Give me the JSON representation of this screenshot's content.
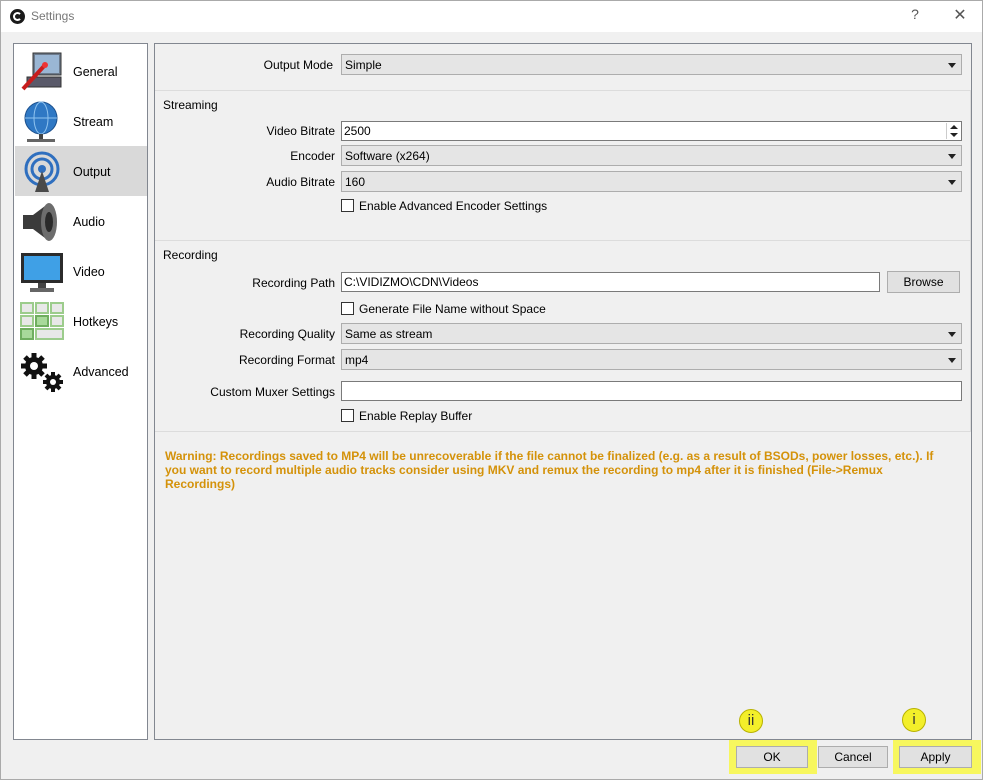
{
  "window": {
    "title": "Settings",
    "help_label": "?",
    "close_label": "✕"
  },
  "sidebar": {
    "items": [
      {
        "label": "General",
        "icon": "general-icon"
      },
      {
        "label": "Stream",
        "icon": "stream-icon"
      },
      {
        "label": "Output",
        "icon": "output-icon",
        "selected": true
      },
      {
        "label": "Audio",
        "icon": "audio-icon"
      },
      {
        "label": "Video",
        "icon": "video-icon"
      },
      {
        "label": "Hotkeys",
        "icon": "hotkeys-icon"
      },
      {
        "label": "Advanced",
        "icon": "advanced-icon"
      }
    ]
  },
  "output": {
    "mode_label": "Output Mode",
    "mode_value": "Simple",
    "streaming": {
      "title": "Streaming",
      "video_bitrate_label": "Video Bitrate",
      "video_bitrate_value": "2500",
      "encoder_label": "Encoder",
      "encoder_value": "Software (x264)",
      "audio_bitrate_label": "Audio Bitrate",
      "audio_bitrate_value": "160",
      "advanced_encoder_label": "Enable Advanced Encoder Settings"
    },
    "recording": {
      "title": "Recording",
      "path_label": "Recording Path",
      "path_value": "C:\\VIDIZMO\\CDN\\Videos",
      "browse_label": "Browse",
      "no_space_label": "Generate File Name without Space",
      "quality_label": "Recording Quality",
      "quality_value": "Same as stream",
      "format_label": "Recording Format",
      "format_value": "mp4",
      "muxer_label": "Custom Muxer Settings",
      "muxer_value": "",
      "replay_label": "Enable Replay Buffer"
    },
    "warning": "Warning: Recordings saved to MP4 will be unrecoverable if the file cannot be finalized (e.g. as a result of BSODs, power losses, etc.). If you want to record multiple audio tracks consider using MKV and remux the recording to mp4 after it is finished (File->Remux Recordings)"
  },
  "buttons": {
    "ok": "OK",
    "cancel": "Cancel",
    "apply": "Apply"
  },
  "annotations": {
    "ok_marker": "ii",
    "apply_marker": "i",
    "highlight_color": "#f7f75e"
  }
}
